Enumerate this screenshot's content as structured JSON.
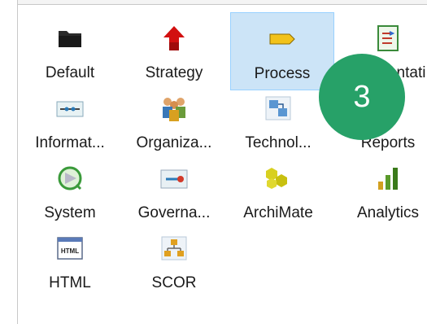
{
  "colors": {
    "selection_bg": "#cce4f7",
    "selection_border": "#99d1ff",
    "badge_bg": "#27a168"
  },
  "tiles": [
    {
      "label": "Default",
      "icon": "folder-icon",
      "selected": false
    },
    {
      "label": "Strategy",
      "icon": "strategy-icon",
      "selected": false
    },
    {
      "label": "Process",
      "icon": "process-icon",
      "selected": true
    },
    {
      "label": "Implementati...",
      "icon": "implementation-icon",
      "selected": false
    },
    {
      "label": "Informat...",
      "icon": "information-icon",
      "selected": false
    },
    {
      "label": "Organiza...",
      "icon": "organization-icon",
      "selected": false
    },
    {
      "label": "Technol...",
      "icon": "technology-icon",
      "selected": false
    },
    {
      "label": "Reports",
      "icon": "reports-icon",
      "selected": false
    },
    {
      "label": "System",
      "icon": "system-icon",
      "selected": false
    },
    {
      "label": "Governa...",
      "icon": "governance-icon",
      "selected": false
    },
    {
      "label": "ArchiMate",
      "icon": "archimate-icon",
      "selected": false
    },
    {
      "label": "Analytics",
      "icon": "analytics-icon",
      "selected": false
    },
    {
      "label": "HTML",
      "icon": "html-icon",
      "selected": false
    },
    {
      "label": "SCOR",
      "icon": "scor-icon",
      "selected": false
    }
  ],
  "badge": {
    "text": "3"
  }
}
